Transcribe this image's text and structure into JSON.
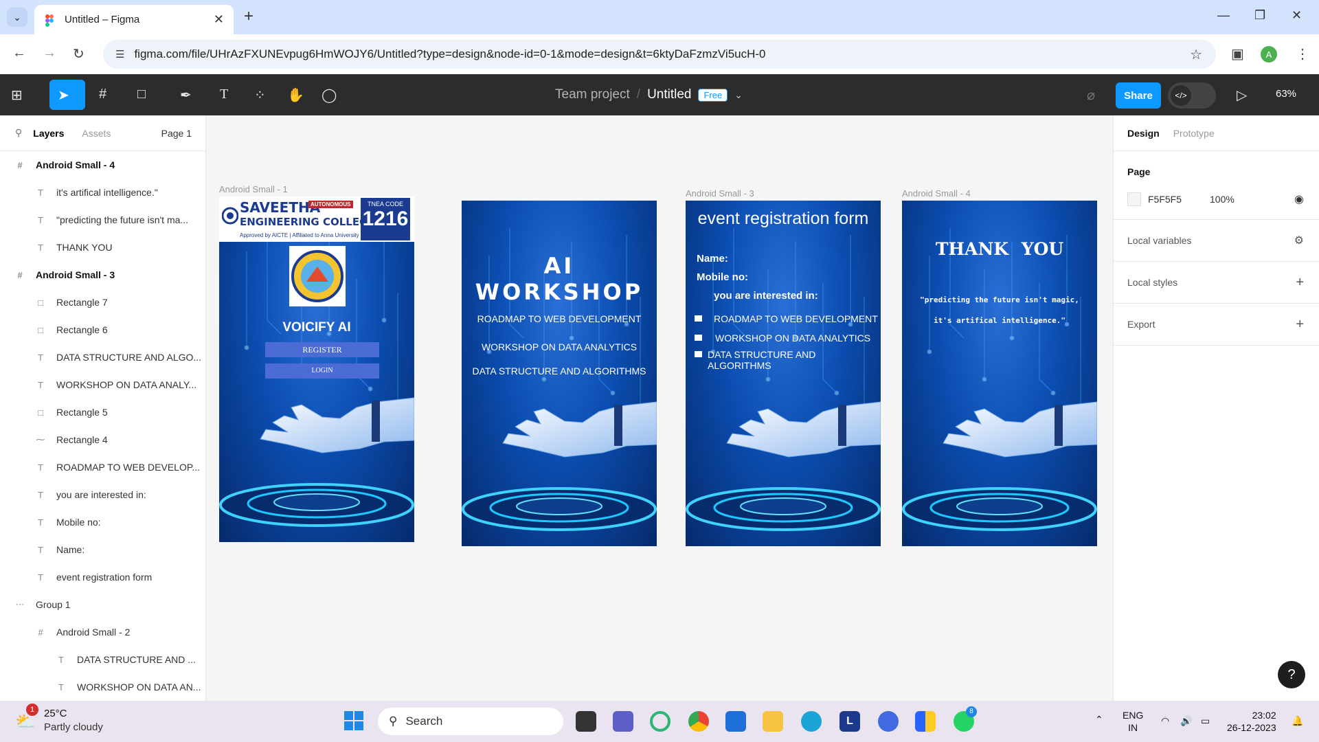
{
  "browser": {
    "tab_title": "Untitled – Figma",
    "url": "figma.com/file/UHrAzFXUNEvpug6HmWOJY6/Untitled?type=design&node-id=0-1&mode=design&t=6ktyDaFzmzVi5ucH-0",
    "avatar_letter": "A"
  },
  "figma": {
    "team": "Team project",
    "sep": "/",
    "file": "Untitled",
    "plan_badge": "Free",
    "share_label": "Share",
    "zoom": "63%"
  },
  "left_panel": {
    "tabs": {
      "layers": "Layers",
      "assets": "Assets",
      "page": "Page 1"
    },
    "layers": [
      {
        "label": "Android Small - 4",
        "icon": "#",
        "indent": 0,
        "bold": true
      },
      {
        "label": "it's artifical intelligence.\"",
        "icon": "T",
        "indent": 1,
        "bold": false
      },
      {
        "label": "\"predicting the future isn't ma...",
        "icon": "T",
        "indent": 1,
        "bold": false
      },
      {
        "label": "THANK YOU",
        "icon": "T",
        "indent": 1,
        "bold": false
      },
      {
        "label": "Android Small - 3",
        "icon": "#",
        "indent": 0,
        "bold": true
      },
      {
        "label": "Rectangle 7",
        "icon": "□",
        "indent": 1,
        "bold": false
      },
      {
        "label": "Rectangle 6",
        "icon": "□",
        "indent": 1,
        "bold": false
      },
      {
        "label": "DATA STRUCTURE AND ALGO...",
        "icon": "T",
        "indent": 1,
        "bold": false
      },
      {
        "label": "WORKSHOP ON DATA ANALY...",
        "icon": "T",
        "indent": 1,
        "bold": false
      },
      {
        "label": "Rectangle 5",
        "icon": "□",
        "indent": 1,
        "bold": false
      },
      {
        "label": "Rectangle 4",
        "icon": "⁓",
        "indent": 1,
        "bold": false
      },
      {
        "label": "ROADMAP TO WEB DEVELOP...",
        "icon": "T",
        "indent": 1,
        "bold": false
      },
      {
        "label": "you are interested in:",
        "icon": "T",
        "indent": 1,
        "bold": false
      },
      {
        "label": "Mobile no:",
        "icon": "T",
        "indent": 1,
        "bold": false
      },
      {
        "label": "Name:",
        "icon": "T",
        "indent": 1,
        "bold": false
      },
      {
        "label": "event registration form",
        "icon": "T",
        "indent": 1,
        "bold": false
      },
      {
        "label": "Group 1",
        "icon": "⋯",
        "indent": 0,
        "bold": false
      },
      {
        "label": "Android Small - 2",
        "icon": "#",
        "indent": 1,
        "bold": false
      },
      {
        "label": "DATA STRUCTURE AND ...",
        "icon": "T",
        "indent": 2,
        "bold": false
      },
      {
        "label": "WORKSHOP ON DATA AN...",
        "icon": "T",
        "indent": 2,
        "bold": false
      }
    ]
  },
  "canvas": {
    "frame1": {
      "label": "Android Small - 1",
      "college_line1": "SAVEETHA",
      "college_line2": "ENGINEERING COLLEGE",
      "autonomous": "AUTONOMOUS",
      "approved": "Approved by AICTE | Affiliated to Anna University",
      "code_label": "TNEA CODE",
      "code": "1216",
      "app_name": "VOICIFY AI",
      "register": "REGISTER",
      "login": "LOGIN"
    },
    "frame2": {
      "title": "AI WORKSHOP",
      "items": [
        "ROADMAP TO WEB DEVELOPMENT",
        "WORKSHOP ON DATA ANALYTICS",
        "DATA STRUCTURE AND ALGORITHMS"
      ]
    },
    "frame3": {
      "label": "Android Small - 3",
      "title": "event registration form",
      "name_label": "Name:",
      "mobile_label": "Mobile no:",
      "interest_label": "you are interested in:",
      "options": [
        "ROADMAP TO WEB DEVELOPMENT",
        "WORKSHOP ON DATA ANALYTICS",
        "DATA STRUCTURE AND ALGORITHMS"
      ]
    },
    "frame4": {
      "label": "Android Small - 4",
      "title": "THANK YOU",
      "quote_line1": "\"predicting the future isn't magic,",
      "quote_line2": "it's artifical intelligence.\""
    }
  },
  "right_panel": {
    "tabs": {
      "design": "Design",
      "prototype": "Prototype"
    },
    "page_section": "Page",
    "bg_hex": "F5F5F5",
    "bg_opacity": "100%",
    "local_variables": "Local variables",
    "local_styles": "Local styles",
    "export": "Export"
  },
  "taskbar": {
    "temp": "25°C",
    "weather": "Partly cloudy",
    "weather_badge": "1",
    "search": "Search",
    "lang1": "ENG",
    "lang2": "IN",
    "time": "23:02",
    "date": "26-12-2023",
    "whatsapp_badge": "8",
    "l_app_letter": "L"
  },
  "colors": {
    "figma_blue": "#0d99ff",
    "toolbar": "#2c2c2c",
    "frame_blue": "#0b4db0"
  }
}
